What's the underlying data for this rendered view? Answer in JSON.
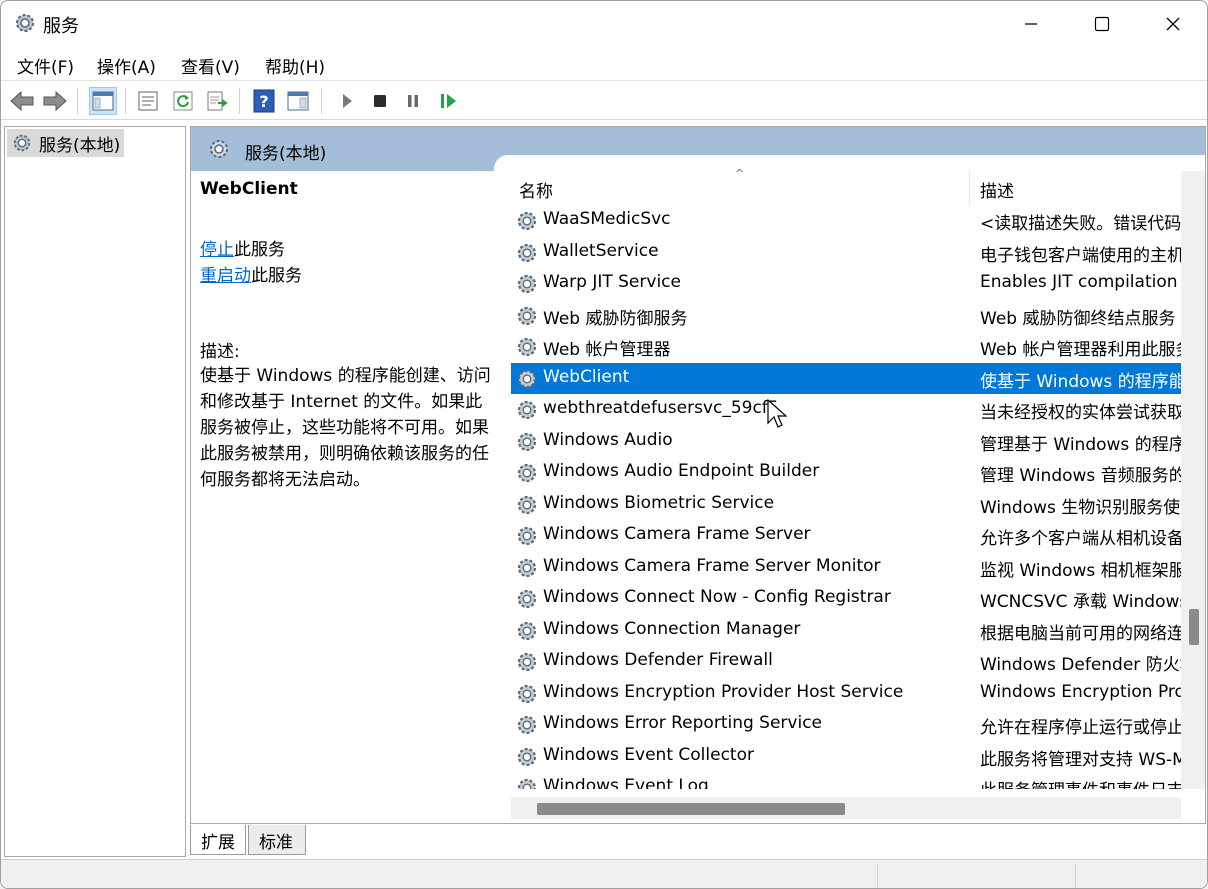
{
  "window": {
    "title": "服务",
    "controls": [
      "minimize-icon",
      "maximize-icon",
      "close-icon"
    ]
  },
  "menu": [
    "文件(F)",
    "操作(A)",
    "查看(V)",
    "帮助(H)"
  ],
  "toolbar": {
    "icons": [
      "back-arrow-icon",
      "forward-arrow-icon",
      "show-tree-icon",
      "properties-icon",
      "refresh-icon",
      "export-list-icon",
      "help-icon",
      "console-icon",
      "start-service-icon",
      "stop-service-icon",
      "pause-service-icon",
      "restart-service-icon"
    ],
    "colors": {
      "play": "#7a7a7a",
      "stop": "#2b2b2b",
      "restart": "#22a04a",
      "help": "#2e5fb5"
    }
  },
  "tree": {
    "root_label": "服务(本地)"
  },
  "panel": {
    "header_title": "服务(本地)",
    "selected_service": "WebClient",
    "stop_link": "停止",
    "stop_suffix": "此服务",
    "restart_link": "重启动",
    "restart_suffix": "此服务",
    "desc_label": "描述:",
    "desc_text": "使基于 Windows 的程序能创建、访问和修改基于 Internet 的文件。如果此服务被停止，这些功能将不可用。如果此服务被禁用，则明确依赖该服务的任何服务都将无法启动。"
  },
  "columns": {
    "name": "名称",
    "description": "描述"
  },
  "services": [
    {
      "name": "WaaSMedicSvc",
      "description": "<读取描述失败。错误代码"
    },
    {
      "name": "WalletService",
      "description": "电子钱包客户端使用的主机"
    },
    {
      "name": "Warp JIT Service",
      "description": "Enables JIT compilation s"
    },
    {
      "name": "Web 威胁防御服务",
      "description": "Web 威胁防御终结点服务"
    },
    {
      "name": "Web 帐户管理器",
      "description": "Web 帐户管理器利用此服务"
    },
    {
      "name": "WebClient",
      "description": "使基于 Windows 的程序能",
      "selected": true
    },
    {
      "name": "webthreatdefusersvc_59cf5",
      "description": "当未经授权的实体尝试获取"
    },
    {
      "name": "Windows Audio",
      "description": "管理基于 Windows 的程序"
    },
    {
      "name": "Windows Audio Endpoint Builder",
      "description": "管理 Windows 音频服务的"
    },
    {
      "name": "Windows Biometric Service",
      "description": "Windows 生物识别服务使"
    },
    {
      "name": "Windows Camera Frame Server",
      "description": "允许多个客户端从相机设备"
    },
    {
      "name": "Windows Camera Frame Server Monitor",
      "description": "监视 Windows 相机框架服"
    },
    {
      "name": "Windows Connect Now - Config Registrar",
      "description": "WCNCSVC 承载 Windows"
    },
    {
      "name": "Windows Connection Manager",
      "description": "根据电脑当前可用的网络连"
    },
    {
      "name": "Windows Defender Firewall",
      "description": "Windows Defender 防火墙"
    },
    {
      "name": "Windows Encryption Provider Host Service",
      "description": "Windows Encryption Prov"
    },
    {
      "name": "Windows Error Reporting Service",
      "description": "允许在程序停止运行或停止"
    },
    {
      "name": "Windows Event Collector",
      "description": "此服务将管理对支持 WS-M"
    },
    {
      "name": "Windows Event Log",
      "description": "此服务管理事件和事件日志"
    }
  ],
  "tabs": [
    "扩展",
    "标准"
  ],
  "accent": "#0078d7",
  "header_color": "#a4bdd8"
}
